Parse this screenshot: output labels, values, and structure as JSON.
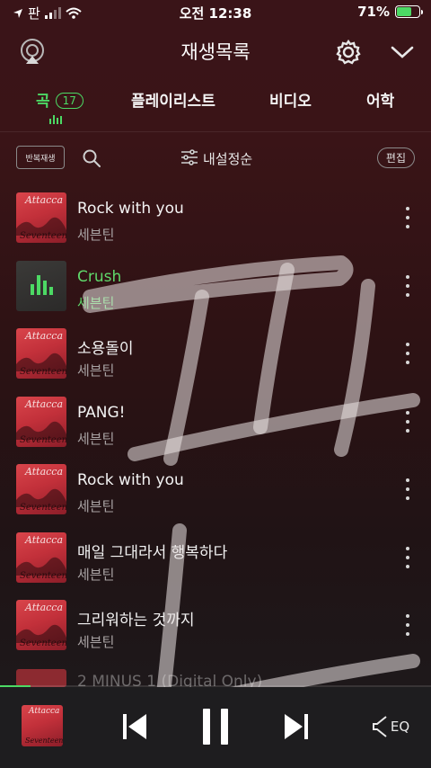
{
  "status_bar": {
    "carrier": "판",
    "time": "오전 12:38",
    "battery": "71%",
    "battery_level": 0.71
  },
  "header": {
    "title": "재생목록",
    "icons": [
      "airplay-icon",
      "gear-icon",
      "chevron-down-icon"
    ]
  },
  "tabs": [
    {
      "label": "곡",
      "count": "17",
      "active": true
    },
    {
      "label": "플레이리스트",
      "active": false
    },
    {
      "label": "비디오",
      "active": false
    },
    {
      "label": "어학",
      "active": false
    }
  ],
  "toolbar": {
    "repeat_label": "반복재생",
    "sort_label": "내설정순",
    "edit_label": "편집"
  },
  "album_art": {
    "title": "Attacca",
    "artist": "Seventeen"
  },
  "songs": [
    {
      "title": "Rock with you",
      "artist": "세븐틴",
      "playing": false
    },
    {
      "title": "Crush",
      "artist": "세븐틴",
      "playing": true
    },
    {
      "title": "소용돌이",
      "artist": "세븐틴",
      "playing": false
    },
    {
      "title": "PANG!",
      "artist": "세븐틴",
      "playing": false
    },
    {
      "title": "Rock with you",
      "artist": "세븐틴",
      "playing": false
    },
    {
      "title": "매일 그대라서 행복하다",
      "artist": "세븐틴",
      "playing": false
    },
    {
      "title": "그리워하는 것까지",
      "artist": "세븐틴",
      "playing": false
    }
  ],
  "partial_song": {
    "title": "2 MINUS 1 (Digital Only)"
  },
  "player": {
    "progress": 0.07,
    "eq_label": "EQ"
  },
  "colors": {
    "accent": "#4cd964",
    "background_top": "#3a1418",
    "background_bottom": "#1c1b1d"
  }
}
